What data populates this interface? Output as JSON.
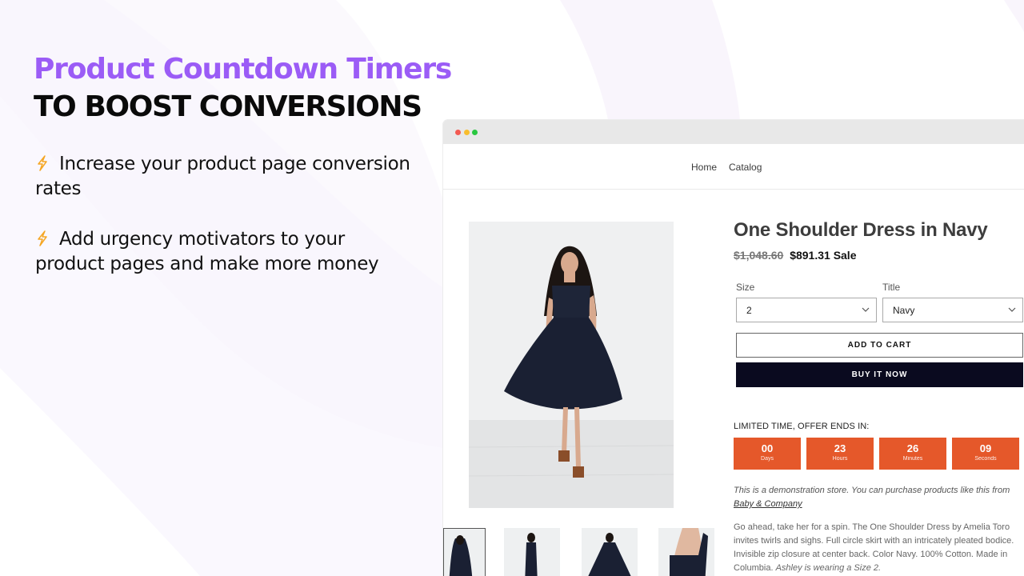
{
  "hero": {
    "title": "Product Countdown Timers",
    "subtitle": "TO BOOST CONVERSIONS",
    "accent_color": "#9b5cf6"
  },
  "bullets": [
    {
      "icon": "lightning-bolt-icon",
      "text": "Increase your product page conversion rates"
    },
    {
      "icon": "lightning-bolt-icon",
      "text": "Add urgency motivators to your product pages and make more money"
    }
  ],
  "store": {
    "nav": {
      "home": "Home",
      "catalog": "Catalog"
    },
    "product": {
      "title": "One Shoulder Dress in Navy",
      "old_price": "$1,048.60",
      "new_price": "$891.31",
      "sale_label": "Sale",
      "size_label": "Size",
      "size_value": "2",
      "title_label": "Title",
      "title_value": "Navy",
      "add_to_cart": "ADD TO CART",
      "buy_now": "BUY IT NOW"
    },
    "timer": {
      "label": "LIMITED TIME, OFFER ENDS IN:",
      "color": "#e5582a",
      "units": [
        {
          "value": "00",
          "unit": "Days"
        },
        {
          "value": "23",
          "unit": "Hours"
        },
        {
          "value": "26",
          "unit": "Minutes"
        },
        {
          "value": "09",
          "unit": "Seconds"
        }
      ]
    },
    "demo_note": "This is a demonstration store. You can purchase products like this from",
    "demo_link": "Baby & Company",
    "description": "Go ahead, take her for a spin. The One Shoulder Dress by Amelia Toro invites twirls and sighs. Full circle skirt with an intricately pleated bodice. Invisible zip closure at center back. Color Navy. 100% Cotton. Made in Columbia.",
    "description_note": "Ashley is wearing a Size 2."
  }
}
